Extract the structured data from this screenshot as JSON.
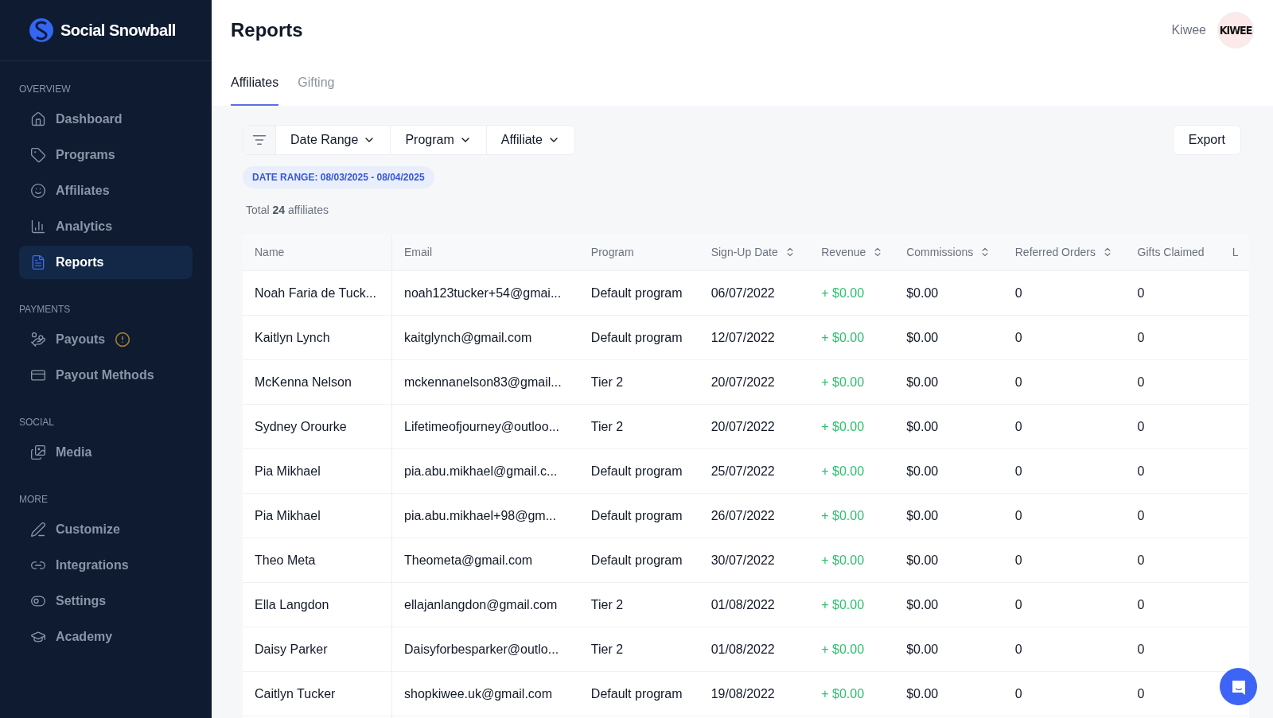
{
  "brand": {
    "name": "Social Snowball"
  },
  "sidebar": {
    "sections": [
      {
        "title": "OVERVIEW",
        "items": [
          {
            "label": "Dashboard",
            "selected": false,
            "alert": false
          },
          {
            "label": "Programs",
            "selected": false,
            "alert": false
          },
          {
            "label": "Affiliates",
            "selected": false,
            "alert": false
          },
          {
            "label": "Analytics",
            "selected": false,
            "alert": false
          },
          {
            "label": "Reports",
            "selected": true,
            "alert": false
          }
        ]
      },
      {
        "title": "PAYMENTS",
        "items": [
          {
            "label": "Payouts",
            "selected": false,
            "alert": true
          },
          {
            "label": "Payout Methods",
            "selected": false,
            "alert": false
          }
        ]
      },
      {
        "title": "SOCIAL",
        "items": [
          {
            "label": "Media",
            "selected": false,
            "alert": false
          }
        ]
      },
      {
        "title": "MORE",
        "items": [
          {
            "label": "Customize",
            "selected": false,
            "alert": false
          },
          {
            "label": "Integrations",
            "selected": false,
            "alert": false
          },
          {
            "label": "Settings",
            "selected": false,
            "alert": false
          },
          {
            "label": "Academy",
            "selected": false,
            "alert": false
          }
        ]
      }
    ]
  },
  "header": {
    "title": "Reports",
    "account": "Kiwee",
    "avatar_text": "KIWEE"
  },
  "tabs": [
    {
      "label": "Affiliates",
      "selected": true
    },
    {
      "label": "Gifting",
      "selected": false
    }
  ],
  "filters": [
    "Date Range",
    "Program",
    "Affiliate"
  ],
  "export_button": "Export",
  "active_filter": "DATE RANGE: 08/03/2025 - 08/04/2025",
  "total": "Total **24** affiliates",
  "table": {
    "columns": [
      {
        "label": "Name",
        "sortable": false
      },
      {
        "label": "Email",
        "sortable": false
      },
      {
        "label": "Program",
        "sortable": false
      },
      {
        "label": "Sign-Up Date",
        "sortable": true
      },
      {
        "label": "Revenue",
        "sortable": true
      },
      {
        "label": "Commissions",
        "sortable": true
      },
      {
        "label": "Referred Orders",
        "sortable": true
      },
      {
        "label": "Gifts Claimed",
        "sortable": false
      },
      {
        "label": "L",
        "sortable": false
      }
    ],
    "rows": [
      [
        "Noah Faria de Tuck...",
        "noah123tucker+54@gmai...",
        "Default program",
        "06/07/2022",
        "+ $0.00",
        "$0.00",
        "0",
        "0"
      ],
      [
        "Kaitlyn Lynch",
        "kaitglynch@gmail.com",
        "Default program",
        "12/07/2022",
        "+ $0.00",
        "$0.00",
        "0",
        "0"
      ],
      [
        "McKenna Nelson",
        "mckennanelson83@gmail...",
        "Tier 2",
        "20/07/2022",
        "+ $0.00",
        "$0.00",
        "0",
        "0"
      ],
      [
        "Sydney Orourke",
        "Lifetimeofjourney@outloo...",
        "Tier 2",
        "20/07/2022",
        "+ $0.00",
        "$0.00",
        "0",
        "0"
      ],
      [
        "Pia Mikhael",
        "pia.abu.mikhael@gmail.c...",
        "Default program",
        "25/07/2022",
        "+ $0.00",
        "$0.00",
        "0",
        "0"
      ],
      [
        "Pia Mikhael",
        "pia.abu.mikhael+98@gm...",
        "Default program",
        "26/07/2022",
        "+ $0.00",
        "$0.00",
        "0",
        "0"
      ],
      [
        "Theo Meta",
        "Theometa@gmail.com",
        "Default program",
        "30/07/2022",
        "+ $0.00",
        "$0.00",
        "0",
        "0"
      ],
      [
        "Ella Langdon",
        "ellajanlangdon@gmail.com",
        "Tier 2",
        "01/08/2022",
        "+ $0.00",
        "$0.00",
        "0",
        "0"
      ],
      [
        "Daisy Parker",
        "Daisyforbesparker@outlo...",
        "Tier 2",
        "01/08/2022",
        "+ $0.00",
        "$0.00",
        "0",
        "0"
      ],
      [
        "Caitlyn Tucker",
        "shopkiwee.uk@gmail.com",
        "Default program",
        "19/08/2022",
        "+ $0.00",
        "$0.00",
        "0",
        "0"
      ]
    ]
  }
}
